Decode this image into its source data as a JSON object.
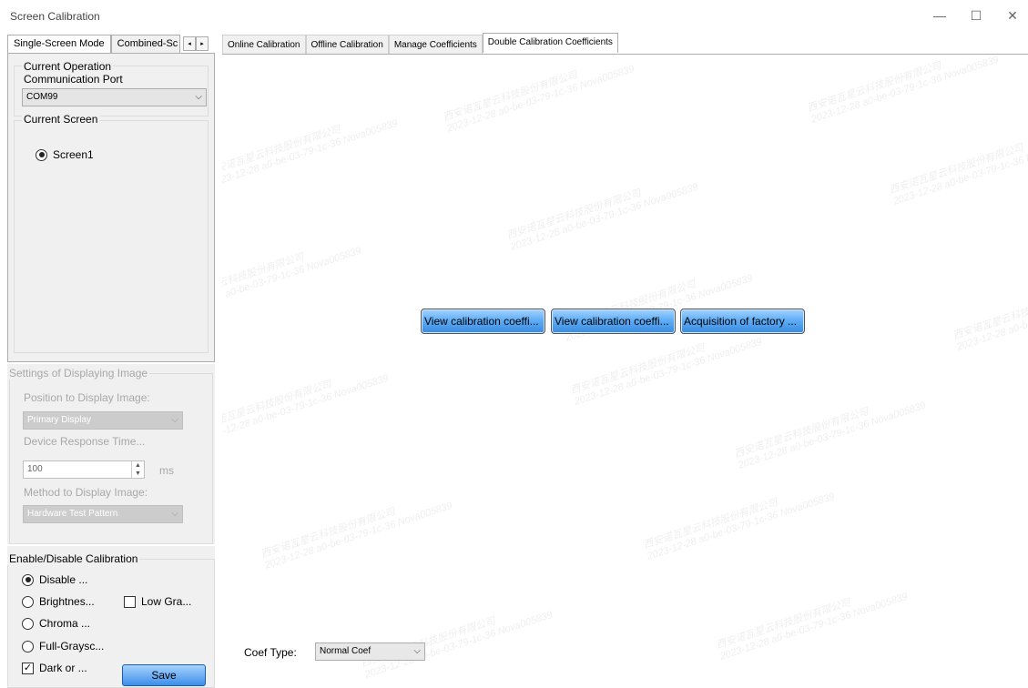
{
  "window": {
    "title": "Screen Calibration",
    "controls": {
      "minimize": "—",
      "maximize": "☐",
      "close": "✕"
    }
  },
  "left_tabs": {
    "items": [
      "Single-Screen Mode",
      "Combined-Sc"
    ],
    "active": 0,
    "scroll_left": "◂",
    "scroll_right": "▸"
  },
  "port_group": {
    "title_line1": "Current Operation",
    "title_line2": "Communication Port",
    "selected": "COM99"
  },
  "screen_group": {
    "title": "Current Screen",
    "screens": [
      {
        "label": "Screen1",
        "selected": true
      }
    ]
  },
  "display_settings": {
    "title": "Settings of Displaying Image",
    "position_label": "Position to Display Image:",
    "position_value": "Primary Display",
    "response_label": "Device Response Time...",
    "response_value": "100",
    "response_unit": "ms",
    "method_label": "Method to Display Image:",
    "method_value": "Hardware Test Pattern"
  },
  "calibration": {
    "title": "Enable/Disable Calibration",
    "options": [
      {
        "label": "Disable ...",
        "selected": true
      },
      {
        "label": "Brightnes...",
        "selected": false
      },
      {
        "label": "Chroma ...",
        "selected": false
      },
      {
        "label": "Full-Graysc...",
        "selected": false
      }
    ],
    "low_gray_label": "Low Gra...",
    "low_gray_checked": false,
    "dark_label": "Dark or ...",
    "dark_checked": true,
    "save_label": "Save"
  },
  "right_tabs": {
    "items": [
      "Online Calibration",
      "Offline Calibration",
      "Manage Coefficients",
      "Double Calibration Coefficients"
    ],
    "active": 3
  },
  "actions": {
    "btn1": "View calibration coeffi...",
    "btn2": "View calibration coeffi...",
    "btn3": "Acquisition of factory ..."
  },
  "coef": {
    "label": "Coef Type:",
    "value": "Normal Coef"
  },
  "watermark": {
    "line1": "西安诺瓦星云科技股份有限公司",
    "line2": "2023-12-28 a0-be-03-79-1c-36 Nova005839"
  }
}
